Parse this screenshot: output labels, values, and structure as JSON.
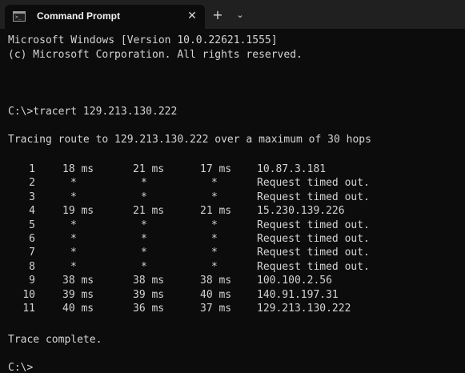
{
  "tabs": [
    {
      "title": "Command Prompt",
      "close_glyph": "✕",
      "icon": "cmd-icon"
    }
  ],
  "tab_actions": {
    "new_tab_glyph": "+",
    "dropdown_glyph": "⌄"
  },
  "console": {
    "header_line_1": "Microsoft Windows [Version 10.0.22621.1555]",
    "header_line_2": "(c) Microsoft Corporation. All rights reserved.",
    "command_line": "C:\\>tracert 129.213.130.222",
    "tracing_line": "Tracing route to 129.213.130.222 over a maximum of 30 hops",
    "hops": [
      {
        "hop": "1",
        "rtt1": "18 ms",
        "rtt2": "21 ms",
        "rtt3": "17 ms",
        "host": "10.87.3.181"
      },
      {
        "hop": "2",
        "rtt1": "*",
        "rtt2": "*",
        "rtt3": "*",
        "host": "Request timed out."
      },
      {
        "hop": "3",
        "rtt1": "*",
        "rtt2": "*",
        "rtt3": "*",
        "host": "Request timed out."
      },
      {
        "hop": "4",
        "rtt1": "19 ms",
        "rtt2": "21 ms",
        "rtt3": "21 ms",
        "host": "15.230.139.226"
      },
      {
        "hop": "5",
        "rtt1": "*",
        "rtt2": "*",
        "rtt3": "*",
        "host": "Request timed out."
      },
      {
        "hop": "6",
        "rtt1": "*",
        "rtt2": "*",
        "rtt3": "*",
        "host": "Request timed out."
      },
      {
        "hop": "7",
        "rtt1": "*",
        "rtt2": "*",
        "rtt3": "*",
        "host": "Request timed out."
      },
      {
        "hop": "8",
        "rtt1": "*",
        "rtt2": "*",
        "rtt3": "*",
        "host": "Request timed out."
      },
      {
        "hop": "9",
        "rtt1": "38 ms",
        "rtt2": "38 ms",
        "rtt3": "38 ms",
        "host": "100.100.2.56"
      },
      {
        "hop": "10",
        "rtt1": "39 ms",
        "rtt2": "39 ms",
        "rtt3": "40 ms",
        "host": "140.91.197.31"
      },
      {
        "hop": "11",
        "rtt1": "40 ms",
        "rtt2": "36 ms",
        "rtt3": "37 ms",
        "host": "129.213.130.222"
      }
    ],
    "complete_line": "Trace complete.",
    "prompt_line": "C:\\>"
  },
  "colors": {
    "background": "#0c0c0c",
    "text": "#d4d4d4",
    "tabstrip": "#202020"
  }
}
